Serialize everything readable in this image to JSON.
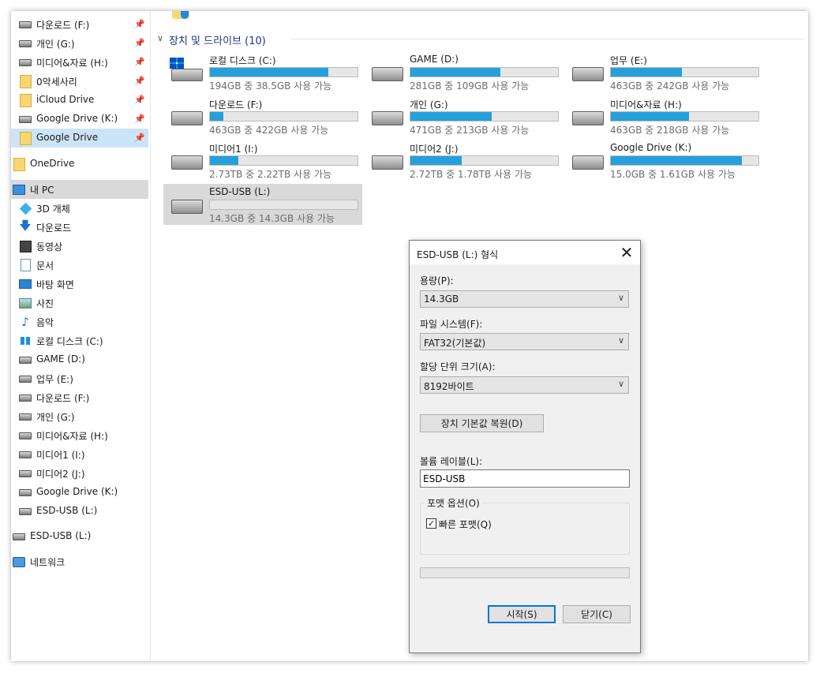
{
  "sidebar": {
    "quick_access": [
      {
        "label": "다운로드 (F:)",
        "icon": "hdd-icon",
        "pinned": true
      },
      {
        "label": "개인 (G:)",
        "icon": "hdd-icon",
        "pinned": true
      },
      {
        "label": "미디어&자료 (H:)",
        "icon": "hdd-icon",
        "pinned": true
      },
      {
        "label": "0악세사리",
        "icon": "folder-icon",
        "pinned": true
      },
      {
        "label": "iCloud Drive",
        "icon": "folder-icon",
        "pinned": true
      },
      {
        "label": "Google Drive (K:)",
        "icon": "hdd-icon",
        "pinned": true
      },
      {
        "label": "Google Drive",
        "icon": "folder-icon",
        "pinned": true
      }
    ],
    "onedrive": "OneDrive",
    "this_pc": "내 PC",
    "pc_items": [
      {
        "label": "3D 개체",
        "icon": "cube-icon"
      },
      {
        "label": "다운로드",
        "icon": "download-arrow-icon"
      },
      {
        "label": "동영상",
        "icon": "film-icon"
      },
      {
        "label": "문서",
        "icon": "document-icon"
      },
      {
        "label": "바탕 화면",
        "icon": "desktop-icon"
      },
      {
        "label": "사진",
        "icon": "pictures-icon"
      },
      {
        "label": "음악",
        "icon": "music-icon"
      },
      {
        "label": "로컬 디스크 (C:)",
        "icon": "windows-drive-icon"
      },
      {
        "label": "GAME (D:)",
        "icon": "hdd-icon"
      },
      {
        "label": "업무 (E:)",
        "icon": "hdd-icon"
      },
      {
        "label": "다운로드 (F:)",
        "icon": "hdd-icon"
      },
      {
        "label": "개인 (G:)",
        "icon": "hdd-icon"
      },
      {
        "label": "미디어&자료 (H:)",
        "icon": "hdd-icon"
      },
      {
        "label": "미디어1 (I:)",
        "icon": "hdd-icon"
      },
      {
        "label": "미디어2 (J:)",
        "icon": "hdd-icon"
      },
      {
        "label": "Google Drive (K:)",
        "icon": "hdd-icon"
      },
      {
        "label": "ESD-USB (L:)",
        "icon": "hdd-icon"
      }
    ],
    "usb": "ESD-USB (L:)",
    "network": "네트워크"
  },
  "devices": {
    "header": "장치 및 드라이브 (10)",
    "drives": [
      {
        "name": "로컬 디스크 (C:)",
        "info": "194GB 중 38.5GB 사용 가능",
        "used_fraction": 0.8,
        "icon": "windows-drive-icon"
      },
      {
        "name": "GAME (D:)",
        "info": "281GB 중 109GB 사용 가능",
        "used_fraction": 0.61,
        "icon": "hdd-icon"
      },
      {
        "name": "업무 (E:)",
        "info": "463GB 중 242GB 사용 가능",
        "used_fraction": 0.48,
        "icon": "hdd-icon"
      },
      {
        "name": "다운로드 (F:)",
        "info": "463GB 중 422GB 사용 가능",
        "used_fraction": 0.09,
        "icon": "hdd-icon"
      },
      {
        "name": "개인 (G:)",
        "info": "471GB 중 213GB 사용 가능",
        "used_fraction": 0.55,
        "icon": "hdd-icon"
      },
      {
        "name": "미디어&자료 (H:)",
        "info": "463GB 중 218GB 사용 가능",
        "used_fraction": 0.53,
        "icon": "hdd-icon"
      },
      {
        "name": "미디어1 (I:)",
        "info": "2.73TB 중 2.22TB 사용 가능",
        "used_fraction": 0.19,
        "icon": "hdd-icon"
      },
      {
        "name": "미디어2 (J:)",
        "info": "2.72TB 중 1.78TB 사용 가능",
        "used_fraction": 0.35,
        "icon": "hdd-icon"
      },
      {
        "name": "Google Drive (K:)",
        "info": "15.0GB 중 1.61GB 사용 가능",
        "used_fraction": 0.89,
        "icon": "hdd-icon"
      },
      {
        "name": "ESD-USB (L:)",
        "info": "14.3GB 중 14.3GB 사용 가능",
        "used_fraction": 0.0,
        "icon": "hdd-icon",
        "selected": true
      }
    ]
  },
  "dialog": {
    "title": "ESD-USB (L:) 형식",
    "capacity_label": "용량(P):",
    "capacity_value": "14.3GB",
    "fs_label": "파일 시스템(F):",
    "fs_value": "FAT32(기본값)",
    "alloc_label": "할당 단위 크기(A):",
    "alloc_value": "8192바이트",
    "restore_button": "장치 기본값 복원(D)",
    "volume_label": "볼륨 레이블(L):",
    "volume_value": "ESD-USB",
    "options_legend": "포맷 옵션(O)",
    "quick_format_label": "빠른 포맷(Q)",
    "quick_format_checked": true,
    "progress_fraction": 0,
    "start_button": "시작(S)",
    "close_button": "닫기(C)"
  },
  "colors": {
    "accent": "#26a0da",
    "selection": "#cce4f7",
    "selected_gray": "#d9d9d9"
  }
}
